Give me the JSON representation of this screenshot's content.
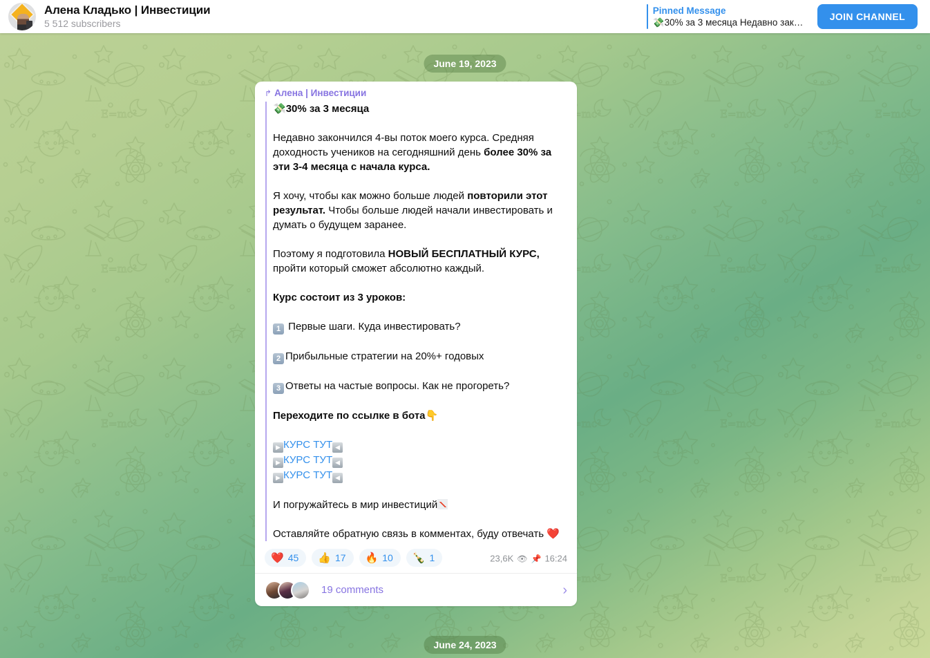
{
  "header": {
    "channel_title": "Алена Кладько | Инвестиции",
    "subscribers": "5 512 subscribers",
    "avatar_name": "channel-avatar",
    "pinned_label": "Pinned Message",
    "pinned_preview": "💸30% за 3 месяца Недавно закон…",
    "join_label": "JOIN CHANNEL",
    "accent_color": "#3390ec"
  },
  "dates": {
    "top": "June 19, 2023",
    "bottom": "June 24, 2023"
  },
  "message": {
    "forward_from": "Алена | Инвестиции",
    "forward_icon": "↱",
    "title_emoji": "💸",
    "title": "30% за 3 месяца",
    "p1_a": "Недавно закончился 4-вы поток моего курса. Средняя доходность учеников на сегодняшний день ",
    "p1_b": "более 30% за эти 3-4 месяца с начала курса.",
    "p2_a": "Я хочу, чтобы как можно больше людей ",
    "p2_b": "повторили этот результат.",
    "p2_c": " Чтобы больше людей начали инвестировать и думать о будущем заранее.",
    "p3_a": "Поэтому я подготовила ",
    "p3_b": "НОВЫЙ БЕСПЛАТНЫЙ КУРС,",
    "p3_c": " пройти который сможет абсолютно каждый.",
    "p4": "Курс состоит из 3 уроков:",
    "lessons": [
      {
        "num": "1",
        "text": " Первые шаги. Куда инвестировать?"
      },
      {
        "num": "2",
        "text": "Прибыльные стратегии на 20%+ годовых"
      },
      {
        "num": "3",
        "text": "Ответы на частые вопросы. Как не прогореть?"
      }
    ],
    "p5": "Переходите по ссылке в бота",
    "p5_emoji": "👇",
    "links": [
      {
        "label": "КУРС ТУТ"
      },
      {
        "label": "КУРС ТУТ"
      },
      {
        "label": "КУРС ТУТ"
      }
    ],
    "link_left_glyph": "▶",
    "link_right_glyph": "◀",
    "p6": "И погружайтесь в мир инвестиций",
    "p7": "Оставляйте обратную связь в комментах, буду отвечать",
    "p7_emoji": "❤️",
    "reactions": [
      {
        "emoji": "❤️",
        "count": "45",
        "name": "heart"
      },
      {
        "emoji": "👍",
        "count": "17",
        "name": "thumbs-up"
      },
      {
        "emoji": "🔥",
        "count": "10",
        "name": "fire"
      },
      {
        "emoji": "🍾",
        "count": "1",
        "name": "champagne"
      }
    ],
    "views": "23,6K",
    "views_icon": "👁",
    "pin_icon": "📌",
    "time": "16:24",
    "comments_label": "19 comments",
    "comments_chevron": "›"
  }
}
